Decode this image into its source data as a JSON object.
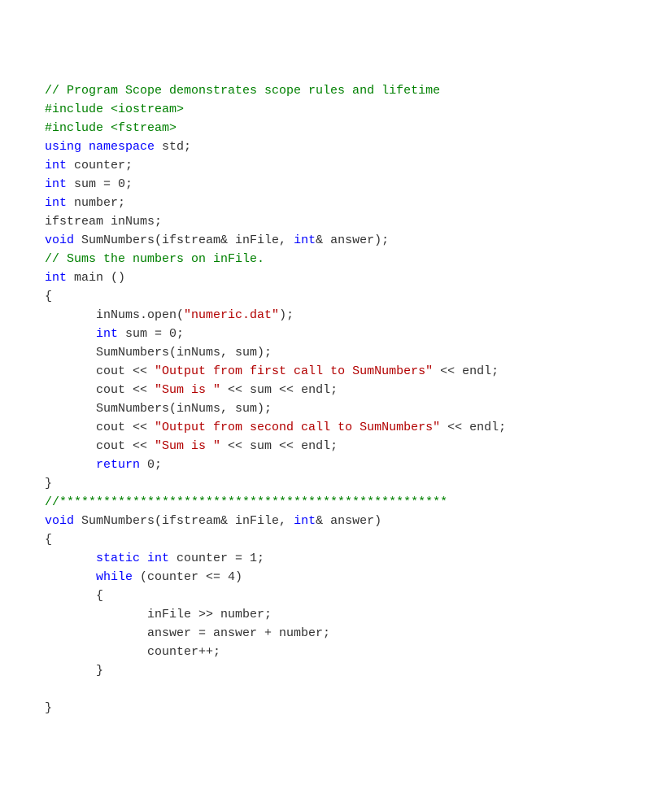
{
  "code": {
    "tokens": [
      [
        {
          "t": "// Program Scope demonstrates scope rules and lifetime",
          "c": "c-green"
        }
      ],
      [
        {
          "t": "#include <iostream>",
          "c": "c-green"
        }
      ],
      [
        {
          "t": "#include <fstream>",
          "c": "c-green"
        }
      ],
      [
        {
          "t": "using namespace",
          "c": "c-blue"
        },
        {
          "t": " std;",
          "c": "c-default"
        }
      ],
      [
        {
          "t": "int",
          "c": "c-blue"
        },
        {
          "t": " counter;",
          "c": "c-default"
        }
      ],
      [
        {
          "t": "int",
          "c": "c-blue"
        },
        {
          "t": " sum = 0;",
          "c": "c-default"
        }
      ],
      [
        {
          "t": "int",
          "c": "c-blue"
        },
        {
          "t": " number;",
          "c": "c-default"
        }
      ],
      [
        {
          "t": "ifstream inNums;",
          "c": "c-default"
        }
      ],
      [
        {
          "t": "void",
          "c": "c-blue"
        },
        {
          "t": " SumNumbers(ifstream& inFile, ",
          "c": "c-default"
        },
        {
          "t": "int",
          "c": "c-blue"
        },
        {
          "t": "& answer);",
          "c": "c-default"
        }
      ],
      [
        {
          "t": "// Sums the numbers on inFile.",
          "c": "c-green"
        }
      ],
      [
        {
          "t": "int",
          "c": "c-blue"
        },
        {
          "t": " main ()",
          "c": "c-default"
        }
      ],
      [
        {
          "t": "{",
          "c": "c-default"
        }
      ],
      [
        {
          "t": "       inNums.open(",
          "c": "c-default"
        },
        {
          "t": "\"numeric.dat\"",
          "c": "c-red"
        },
        {
          "t": ");",
          "c": "c-default"
        }
      ],
      [
        {
          "t": "       ",
          "c": "c-default"
        },
        {
          "t": "int",
          "c": "c-blue"
        },
        {
          "t": " sum = 0;",
          "c": "c-default"
        }
      ],
      [
        {
          "t": "       SumNumbers(inNums, sum);",
          "c": "c-default"
        }
      ],
      [
        {
          "t": "       cout << ",
          "c": "c-default"
        },
        {
          "t": "\"Output from first call to SumNumbers\"",
          "c": "c-red"
        },
        {
          "t": " << endl;",
          "c": "c-default"
        }
      ],
      [
        {
          "t": "       cout << ",
          "c": "c-default"
        },
        {
          "t": "\"Sum is \"",
          "c": "c-red"
        },
        {
          "t": " << sum << endl;",
          "c": "c-default"
        }
      ],
      [
        {
          "t": "       SumNumbers(inNums, sum);",
          "c": "c-default"
        }
      ],
      [
        {
          "t": "       cout << ",
          "c": "c-default"
        },
        {
          "t": "\"Output from second call to SumNumbers\"",
          "c": "c-red"
        },
        {
          "t": " << endl;",
          "c": "c-default"
        }
      ],
      [
        {
          "t": "       cout << ",
          "c": "c-default"
        },
        {
          "t": "\"Sum is \"",
          "c": "c-red"
        },
        {
          "t": " << sum << endl;",
          "c": "c-default"
        }
      ],
      [
        {
          "t": "       ",
          "c": "c-default"
        },
        {
          "t": "return",
          "c": "c-blue"
        },
        {
          "t": " 0;",
          "c": "c-default"
        }
      ],
      [
        {
          "t": "}",
          "c": "c-default"
        }
      ],
      [
        {
          "t": "//*****************************************************",
          "c": "c-green"
        }
      ],
      [
        {
          "t": "void",
          "c": "c-blue"
        },
        {
          "t": " SumNumbers(ifstream& inFile, ",
          "c": "c-default"
        },
        {
          "t": "int",
          "c": "c-blue"
        },
        {
          "t": "& answer)",
          "c": "c-default"
        }
      ],
      [
        {
          "t": "{",
          "c": "c-default"
        }
      ],
      [
        {
          "t": "       ",
          "c": "c-default"
        },
        {
          "t": "static int",
          "c": "c-blue"
        },
        {
          "t": " counter = 1;",
          "c": "c-default"
        }
      ],
      [
        {
          "t": "       ",
          "c": "c-default"
        },
        {
          "t": "while",
          "c": "c-blue"
        },
        {
          "t": " (counter <= 4)",
          "c": "c-default"
        }
      ],
      [
        {
          "t": "       {",
          "c": "c-default"
        }
      ],
      [
        {
          "t": "              inFile >> number;",
          "c": "c-default"
        }
      ],
      [
        {
          "t": "              answer = answer + number;",
          "c": "c-default"
        }
      ],
      [
        {
          "t": "              counter++;",
          "c": "c-default"
        }
      ],
      [
        {
          "t": "       }",
          "c": "c-default"
        }
      ],
      [
        {
          "t": "",
          "c": "c-default"
        }
      ],
      [
        {
          "t": "}",
          "c": "c-default"
        }
      ]
    ]
  }
}
